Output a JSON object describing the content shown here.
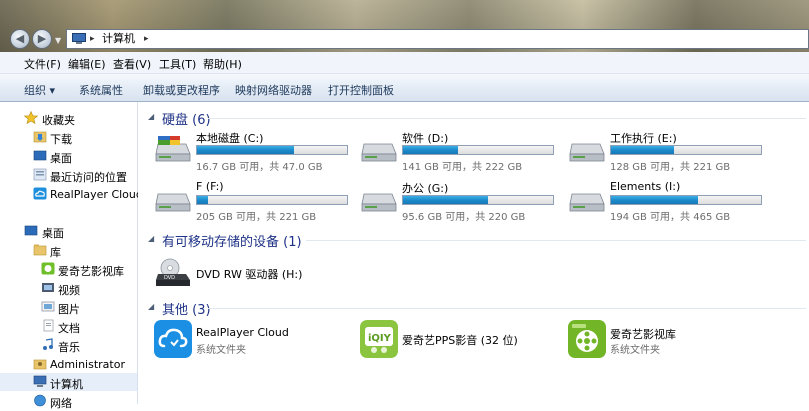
{
  "address": {
    "location": "计算机"
  },
  "menu": [
    "文件(F)",
    "编辑(E)",
    "查看(V)",
    "工具(T)",
    "帮助(H)"
  ],
  "commands": {
    "organize": "组织 ▾",
    "items": [
      "系统属性",
      "卸载或更改程序",
      "映射网络驱动器",
      "打开控制面板"
    ]
  },
  "nav": {
    "favorites": "收藏夹",
    "fav_items": [
      "下载",
      "桌面",
      "最近访问的位置",
      "RealPlayer Cloud"
    ],
    "desktop": "桌面",
    "library": "库",
    "lib_items": [
      "爱奇艺影视库",
      "视频",
      "图片",
      "文档",
      "音乐"
    ],
    "admin": "Administrator",
    "computer": "计算机",
    "network": "网络"
  },
  "groups": {
    "hdd": "硬盘 (6)",
    "removable": "有可移动存储的设备 (1)",
    "other": "其他 (3)"
  },
  "drives": [
    {
      "name": "本地磁盘 (C:)",
      "info": "16.7 GB 可用，共 47.0 GB",
      "used_fraction": 0.645
    },
    {
      "name": "软件 (D:)",
      "info": "141 GB 可用，共 222 GB",
      "used_fraction": 0.365
    },
    {
      "name": "工作执行 (E:)",
      "info": "128 GB 可用，共 221 GB",
      "used_fraction": 0.42
    },
    {
      "name": "F (F:)",
      "info": "205 GB 可用，共 221 GB",
      "used_fraction": 0.072
    },
    {
      "name": "办公 (G:)",
      "info": "95.6 GB 可用，共 220 GB",
      "used_fraction": 0.565
    },
    {
      "name": "Elements (I:)",
      "info": "194 GB 可用，共 465 GB",
      "used_fraction": 0.583
    }
  ],
  "dvd": {
    "name": "DVD RW 驱动器 (H:)"
  },
  "others": [
    {
      "name": "RealPlayer Cloud",
      "sub": "系统文件夹",
      "icon": "realplayer-cloud-icon"
    },
    {
      "name": "爱奇艺PPS影音 (32 位)",
      "sub": "",
      "icon": "iqiyi-icon"
    },
    {
      "name": "爱奇艺影视库",
      "sub": "系统文件夹",
      "icon": "iqiyi-film-library-icon"
    }
  ],
  "colors": {
    "accent": "#1e3287",
    "bar_fill": "#1d8bcc"
  }
}
